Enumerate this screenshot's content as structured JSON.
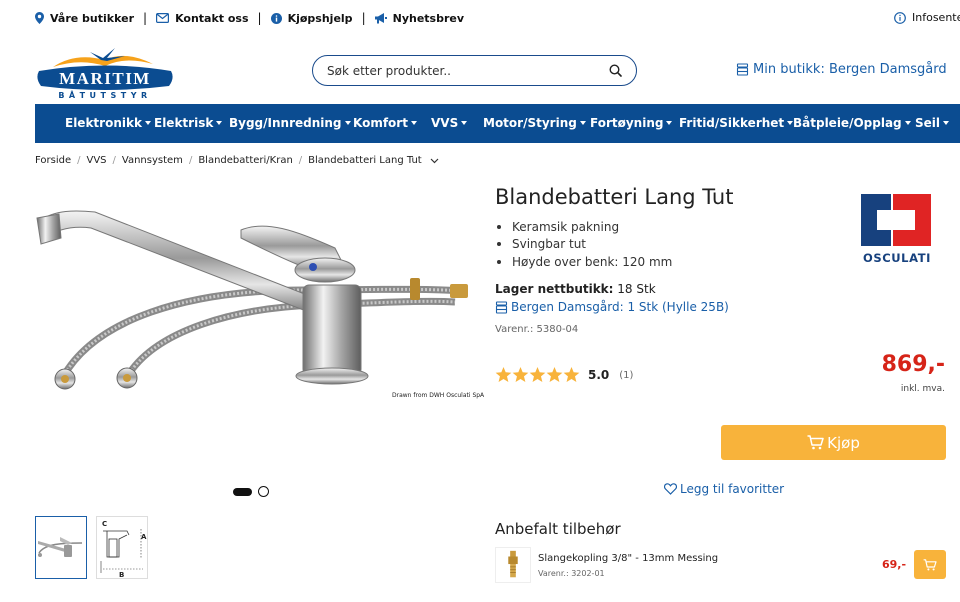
{
  "topbar": {
    "stores": "Våre butikker",
    "contact": "Kontakt oss",
    "help": "Kjøpshjelp",
    "newsletter": "Nyhetsbrev",
    "info": "Infosente"
  },
  "header": {
    "logo_text": "MARITIM",
    "logo_sub": "BÅTUTSTYR",
    "search_placeholder": "Søk etter produkter..",
    "my_store": "Min butikk: Bergen Damsgård"
  },
  "nav": {
    "items": [
      "Elektronikk",
      "Elektrisk",
      "Bygg/Innredning",
      "Komfort",
      "VVS",
      "Motor/Styring",
      "Fortøyning",
      "Fritid/Sikkerhet",
      "Båtpleie/Opplag",
      "Seil"
    ]
  },
  "breadcrumb": [
    "Forside",
    "VVS",
    "Vannsystem",
    "Blandebatteri/Kran",
    "Blandebatteri Lang Tut"
  ],
  "product": {
    "title": "Blandebatteri Lang Tut",
    "features": [
      "Keramsik pakning",
      "Svingbar tut",
      "Høyde over benk: 120 mm"
    ],
    "brand": "OSCULATI",
    "stock_label": "Lager nettbutikk:",
    "stock_value": "18 Stk",
    "store_stock": "Bergen Damsgård: 1 Stk (Hylle 25B)",
    "varenr": "Varenr.: 5380-04",
    "rating": 5.0,
    "rating_text": "5.0",
    "rating_count": "(1)",
    "price": "869,-",
    "price_note": "inkl. mva.",
    "buy_label": "Kjøp",
    "favorite_label": "Legg til favoritter",
    "image_caption": "Drawn from DWH Osculati SpA",
    "thumb_labels": [
      "C",
      "A",
      "B"
    ]
  },
  "accessories": {
    "title": "Anbefalt tilbehør",
    "items": [
      {
        "name": "Slangekopling 3/8\" - 13mm Messing",
        "varenr": "Varenr.: 3202-01",
        "price": "69,-"
      }
    ]
  },
  "colors": {
    "nav_bg": "#0b4c91",
    "link": "#1a5fa8",
    "price": "#d62418",
    "buy": "#f8b33b",
    "star": "#f8b33b"
  }
}
